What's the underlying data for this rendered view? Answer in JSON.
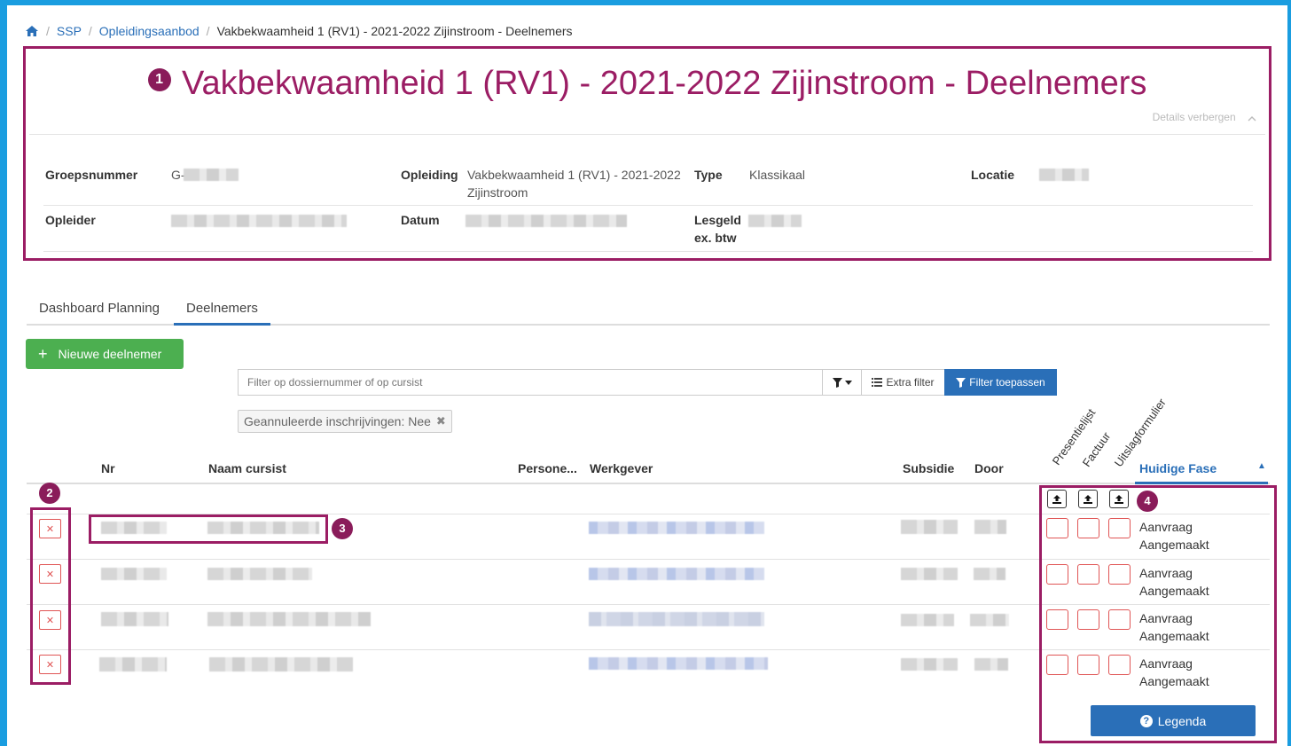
{
  "breadcrumb": {
    "home_icon": "home-icon",
    "items": [
      "SSP",
      "Opleidingsaanbod"
    ],
    "current": "Vakbekwaamheid 1 (RV1) - 2021-2022 Zijinstroom - Deelnemers"
  },
  "header": {
    "step": "1",
    "title": "Vakbekwaamheid 1 (RV1) - 2021-2022 Zijinstroom - Deelnemers",
    "details_toggle": "Details verbergen",
    "fields": {
      "groepsnummer_label": "Groepsnummer",
      "groepsnummer_value": "G-",
      "opleiding_label": "Opleiding",
      "opleiding_value_line1": "Vakbekwaamheid 1 (RV1) - 2021-2022",
      "opleiding_value_line2": "Zijinstroom",
      "type_label": "Type",
      "type_value": "Klassikaal",
      "locatie_label": "Locatie",
      "opleider_label": "Opleider",
      "datum_label": "Datum",
      "lesgeld_label_line1": "Lesgeld",
      "lesgeld_label_line2": "ex. btw"
    }
  },
  "tabs": [
    {
      "label": "Dashboard Planning",
      "active": false
    },
    {
      "label": "Deelnemers",
      "active": true
    }
  ],
  "actions": {
    "new_participant": "Nieuwe deelnemer",
    "filter_placeholder": "Filter op dossiernummer of op cursist",
    "extra_filter": "Extra filter",
    "apply_filter": "Filter toepassen",
    "active_filter_chip": "Geannuleerde inschrijvingen: Nee"
  },
  "table": {
    "columns": {
      "nr": "Nr",
      "naam": "Naam cursist",
      "personeel": "Persone...",
      "werkgever": "Werkgever",
      "subsidie": "Subsidie",
      "door": "Door",
      "presentielijst": "Presentielijst",
      "factuur": "Factuur",
      "uitslagformulier": "Uitslagformulier",
      "fase": "Huidige Fase"
    },
    "rows": [
      {
        "fase_line1": "Aanvraag",
        "fase_line2": "Aangemaakt"
      },
      {
        "fase_line1": "Aanvraag",
        "fase_line2": "Aangemaakt"
      },
      {
        "fase_line1": "Aanvraag",
        "fase_line2": "Aangemaakt"
      },
      {
        "fase_line1": "Aanvraag",
        "fase_line2": "Aangemaakt"
      }
    ]
  },
  "annotations": {
    "two": "2",
    "three": "3",
    "four": "4"
  },
  "legend_button": "Legenda",
  "colors": {
    "accent": "#9b1d64",
    "primary": "#2a6fb8",
    "success": "#4caf50",
    "danger": "#e05555",
    "frame": "#1a9de0"
  }
}
